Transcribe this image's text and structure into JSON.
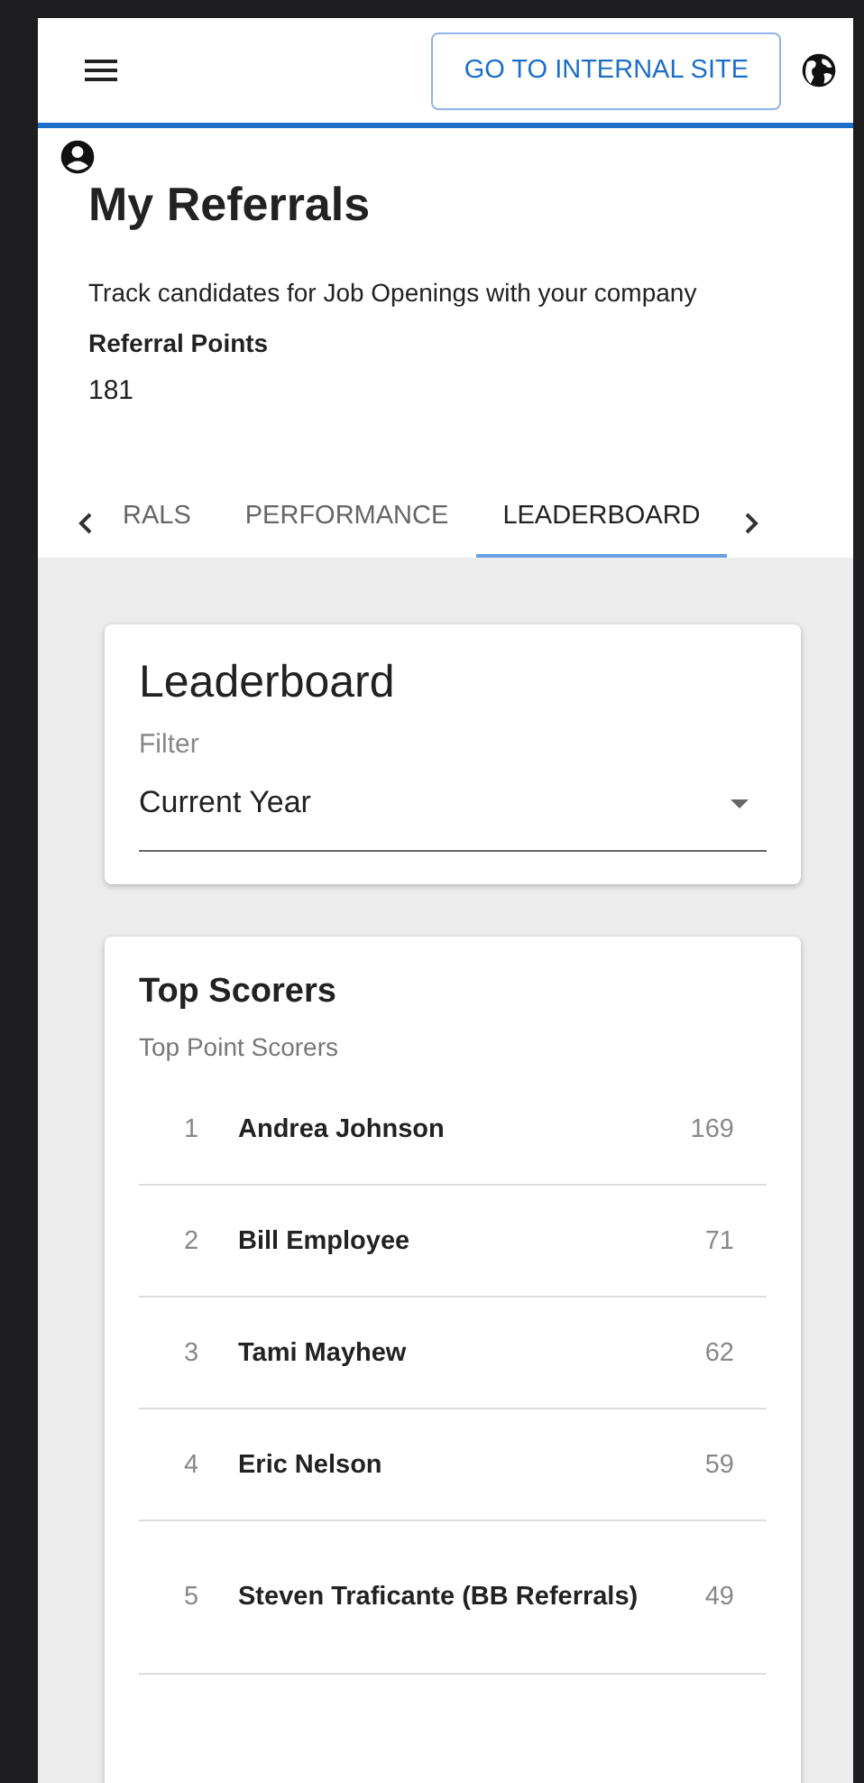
{
  "header": {
    "button": "GO TO INTERNAL SITE"
  },
  "page": {
    "title": "My Referrals",
    "description": "Track candidates for Job Openings with your company",
    "points_label": "Referral Points",
    "points": "181"
  },
  "tabs": [
    {
      "label": "RALS",
      "selected": false
    },
    {
      "label": "PERFORMANCE",
      "selected": false
    },
    {
      "label": "LEADERBOARD",
      "selected": true
    }
  ],
  "leaderboard": {
    "title": "Leaderboard",
    "filter_label": "Filter",
    "filter_value": "Current Year"
  },
  "top_scorers": {
    "title": "Top Scorers",
    "subtitle": "Top Point Scorers",
    "rows": [
      {
        "rank": "1",
        "name": "Andrea Johnson",
        "points": "169"
      },
      {
        "rank": "2",
        "name": "Bill Employee",
        "points": "71"
      },
      {
        "rank": "3",
        "name": "Tami Mayhew",
        "points": "62"
      },
      {
        "rank": "4",
        "name": "Eric Nelson",
        "points": "59"
      },
      {
        "rank": "5",
        "name": "Steven Traficante (BB Referrals)",
        "points": "49"
      }
    ]
  }
}
